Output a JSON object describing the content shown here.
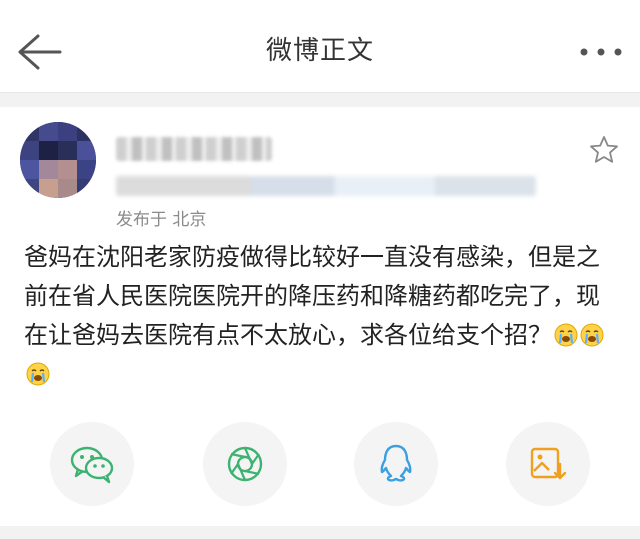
{
  "header": {
    "title": "微博正文"
  },
  "post": {
    "location": "发布于 北京",
    "text": "爸妈在沈阳老家防疫做得比较好一直没有感染，但是之前在省人民医院医院开的降压药和降糖药都吃完了，现在让爸妈去医院有点不太放心，求各位给支个招？"
  },
  "share": {
    "icons": [
      "wechat-icon",
      "moments-icon",
      "qq-icon",
      "save-image-icon"
    ],
    "colors": {
      "wechat": "#3cb371",
      "moments": "#3cb371",
      "qq": "#3aa0e0",
      "save": "#f0a020"
    }
  },
  "colors": {
    "background": "#ffffff",
    "separator": "#f2f2f2",
    "location_text": "#8a8a8a"
  }
}
